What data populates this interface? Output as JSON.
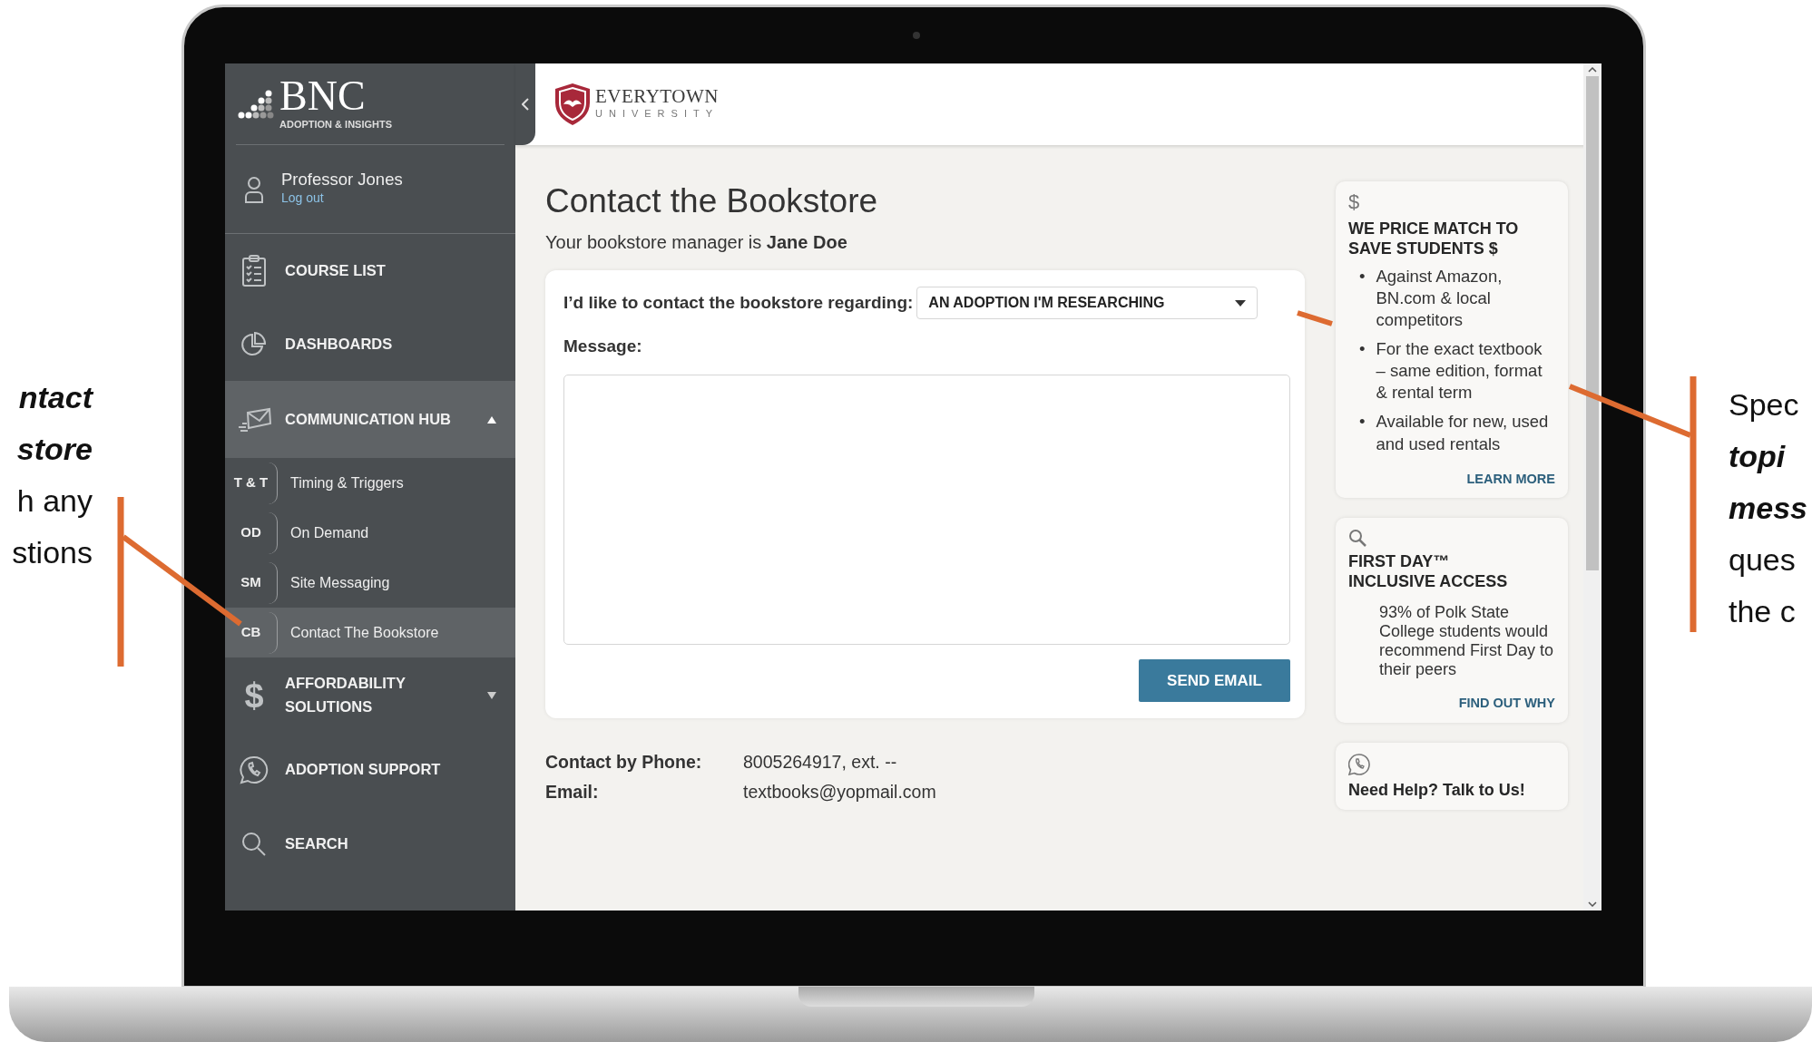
{
  "callouts": {
    "left": [
      {
        "text": "ntact",
        "emphasis": true
      },
      {
        "text": "store",
        "emphasis": true
      },
      {
        "text": "h any",
        "emphasis": false
      },
      {
        "text": "stions",
        "emphasis": false
      }
    ],
    "right": [
      {
        "text": "Spec",
        "emphasis": false
      },
      {
        "text": "topi",
        "emphasis": true
      },
      {
        "text": "mess",
        "emphasis": true
      },
      {
        "text": "ques",
        "emphasis": false
      },
      {
        "text": "the c",
        "emphasis": false
      }
    ]
  },
  "sidebar": {
    "logo": {
      "mark": "BNC",
      "tagline": "ADOPTION & INSIGHTS"
    },
    "user": {
      "name": "Professor Jones",
      "logout": "Log out"
    },
    "items": [
      {
        "kind": "item",
        "label": "COURSE LIST",
        "selected": false
      },
      {
        "kind": "item",
        "label": "DASHBOARDS",
        "selected": false
      },
      {
        "kind": "group",
        "label": "COMMUNICATION HUB",
        "selected": true,
        "expanded": true,
        "children": [
          {
            "abbr": "T & T",
            "label": "Timing & Triggers",
            "selected": false
          },
          {
            "abbr": "OD",
            "label": "On Demand",
            "selected": false
          },
          {
            "abbr": "SM",
            "label": "Site Messaging",
            "selected": false
          },
          {
            "abbr": "CB",
            "label": "Contact The Bookstore",
            "selected": true
          }
        ]
      },
      {
        "kind": "group",
        "label": "AFFORDABILITY SOLUTIONS",
        "icon_char": "$",
        "selected": false,
        "expanded": false
      },
      {
        "kind": "item",
        "label": "ADOPTION SUPPORT",
        "selected": false
      },
      {
        "kind": "item",
        "label": "SEARCH",
        "selected": false
      }
    ]
  },
  "header": {
    "school": "EVERYTOWN",
    "school_sub": "UNIVERSITY"
  },
  "main": {
    "title": "Contact the Bookstore",
    "manager": "Your bookstore manager is **Jane Doe**",
    "form": {
      "topic_label": "I’d like to contact the bookstore regarding:",
      "topic_value": "AN ADOPTION I'M RESEARCHING",
      "message_label": "Message:",
      "button": "SEND EMAIL"
    },
    "contact": [
      {
        "label": "Contact by Phone:",
        "value": "8005264917, ext. --"
      },
      {
        "label": "Email:",
        "value": "textbooks@yopmail.com"
      }
    ]
  },
  "promos": [
    {
      "icon_char": "$",
      "title": "WE PRICE MATCH TO SAVE STUDENTS $",
      "bullets": [
        {
          "marker": "•",
          "text": "Against Amazon, BN.com & local competitors"
        },
        {
          "marker": "•",
          "text": "For the exact textbook – same edition, format & rental term"
        },
        {
          "marker": "•",
          "text": "Available for new, used and used rentals"
        }
      ],
      "link": "LEARN MORE"
    },
    {
      "title": "FIRST DAY™ INCLUSIVE ACCESS",
      "text": "93% of Polk State College students would recommend First Day to their peers",
      "link": "FIND OUT WHY"
    },
    {
      "title": "Need Help? Talk to Us!"
    }
  ]
}
